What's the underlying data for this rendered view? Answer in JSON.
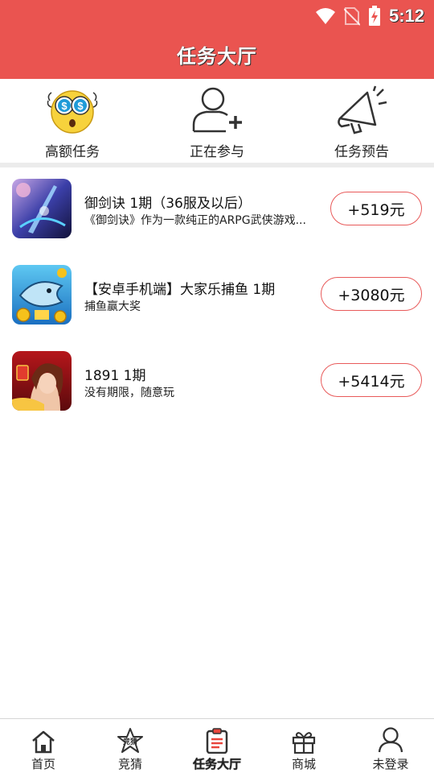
{
  "status_bar": {
    "time": "5:12"
  },
  "header": {
    "title": "任务大厅"
  },
  "categories": [
    {
      "label": "高额任务",
      "icon": "money-eyes-emoji-icon"
    },
    {
      "label": "正在参与",
      "icon": "add-user-icon"
    },
    {
      "label": "任务预告",
      "icon": "megaphone-icon"
    }
  ],
  "tasks": [
    {
      "name": "御剑诀 1期（36服及以后）",
      "desc": "《御剑诀》作为一款纯正的ARPG武侠游戏...",
      "reward": "+519元"
    },
    {
      "name": "【安卓手机端】大家乐捕鱼 1期",
      "desc": "捕鱼赢大奖",
      "reward": "+3080元"
    },
    {
      "name": "1891 1期",
      "desc": "没有期限，随意玩",
      "reward": "+5414元"
    }
  ],
  "bottom_nav": [
    {
      "label": "首页",
      "icon": "home-icon",
      "active": false
    },
    {
      "label": "竞猜",
      "icon": "guess-star-icon",
      "icon_text": "竞猜",
      "active": false
    },
    {
      "label": "任务大厅",
      "icon": "clipboard-icon",
      "active": true
    },
    {
      "label": "商城",
      "icon": "gift-icon",
      "active": false
    },
    {
      "label": "未登录",
      "icon": "user-icon",
      "active": false
    }
  ],
  "colors": {
    "brand_red": "#ea5450",
    "reward_border": "#e85a5a"
  }
}
